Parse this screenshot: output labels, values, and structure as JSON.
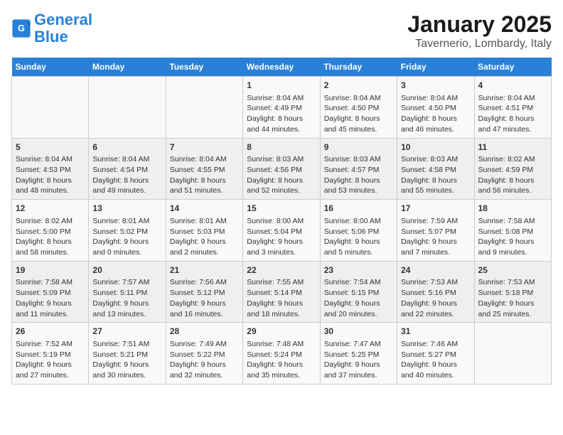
{
  "header": {
    "logo_line1": "General",
    "logo_line2": "Blue",
    "month": "January 2025",
    "location": "Tavernerio, Lombardy, Italy"
  },
  "days_of_week": [
    "Sunday",
    "Monday",
    "Tuesday",
    "Wednesday",
    "Thursday",
    "Friday",
    "Saturday"
  ],
  "weeks": [
    [
      {
        "day": "",
        "data": ""
      },
      {
        "day": "",
        "data": ""
      },
      {
        "day": "",
        "data": ""
      },
      {
        "day": "1",
        "data": "Sunrise: 8:04 AM\nSunset: 4:49 PM\nDaylight: 8 hours and 44 minutes."
      },
      {
        "day": "2",
        "data": "Sunrise: 8:04 AM\nSunset: 4:50 PM\nDaylight: 8 hours and 45 minutes."
      },
      {
        "day": "3",
        "data": "Sunrise: 8:04 AM\nSunset: 4:50 PM\nDaylight: 8 hours and 46 minutes."
      },
      {
        "day": "4",
        "data": "Sunrise: 8:04 AM\nSunset: 4:51 PM\nDaylight: 8 hours and 47 minutes."
      }
    ],
    [
      {
        "day": "5",
        "data": "Sunrise: 8:04 AM\nSunset: 4:53 PM\nDaylight: 8 hours and 48 minutes."
      },
      {
        "day": "6",
        "data": "Sunrise: 8:04 AM\nSunset: 4:54 PM\nDaylight: 8 hours and 49 minutes."
      },
      {
        "day": "7",
        "data": "Sunrise: 8:04 AM\nSunset: 4:55 PM\nDaylight: 8 hours and 51 minutes."
      },
      {
        "day": "8",
        "data": "Sunrise: 8:03 AM\nSunset: 4:56 PM\nDaylight: 8 hours and 52 minutes."
      },
      {
        "day": "9",
        "data": "Sunrise: 8:03 AM\nSunset: 4:57 PM\nDaylight: 8 hours and 53 minutes."
      },
      {
        "day": "10",
        "data": "Sunrise: 8:03 AM\nSunset: 4:58 PM\nDaylight: 8 hours and 55 minutes."
      },
      {
        "day": "11",
        "data": "Sunrise: 8:02 AM\nSunset: 4:59 PM\nDaylight: 8 hours and 56 minutes."
      }
    ],
    [
      {
        "day": "12",
        "data": "Sunrise: 8:02 AM\nSunset: 5:00 PM\nDaylight: 8 hours and 58 minutes."
      },
      {
        "day": "13",
        "data": "Sunrise: 8:01 AM\nSunset: 5:02 PM\nDaylight: 9 hours and 0 minutes."
      },
      {
        "day": "14",
        "data": "Sunrise: 8:01 AM\nSunset: 5:03 PM\nDaylight: 9 hours and 2 minutes."
      },
      {
        "day": "15",
        "data": "Sunrise: 8:00 AM\nSunset: 5:04 PM\nDaylight: 9 hours and 3 minutes."
      },
      {
        "day": "16",
        "data": "Sunrise: 8:00 AM\nSunset: 5:06 PM\nDaylight: 9 hours and 5 minutes."
      },
      {
        "day": "17",
        "data": "Sunrise: 7:59 AM\nSunset: 5:07 PM\nDaylight: 9 hours and 7 minutes."
      },
      {
        "day": "18",
        "data": "Sunrise: 7:58 AM\nSunset: 5:08 PM\nDaylight: 9 hours and 9 minutes."
      }
    ],
    [
      {
        "day": "19",
        "data": "Sunrise: 7:58 AM\nSunset: 5:09 PM\nDaylight: 9 hours and 11 minutes."
      },
      {
        "day": "20",
        "data": "Sunrise: 7:57 AM\nSunset: 5:11 PM\nDaylight: 9 hours and 13 minutes."
      },
      {
        "day": "21",
        "data": "Sunrise: 7:56 AM\nSunset: 5:12 PM\nDaylight: 9 hours and 16 minutes."
      },
      {
        "day": "22",
        "data": "Sunrise: 7:55 AM\nSunset: 5:14 PM\nDaylight: 9 hours and 18 minutes."
      },
      {
        "day": "23",
        "data": "Sunrise: 7:54 AM\nSunset: 5:15 PM\nDaylight: 9 hours and 20 minutes."
      },
      {
        "day": "24",
        "data": "Sunrise: 7:53 AM\nSunset: 5:16 PM\nDaylight: 9 hours and 22 minutes."
      },
      {
        "day": "25",
        "data": "Sunrise: 7:53 AM\nSunset: 5:18 PM\nDaylight: 9 hours and 25 minutes."
      }
    ],
    [
      {
        "day": "26",
        "data": "Sunrise: 7:52 AM\nSunset: 5:19 PM\nDaylight: 9 hours and 27 minutes."
      },
      {
        "day": "27",
        "data": "Sunrise: 7:51 AM\nSunset: 5:21 PM\nDaylight: 9 hours and 30 minutes."
      },
      {
        "day": "28",
        "data": "Sunrise: 7:49 AM\nSunset: 5:22 PM\nDaylight: 9 hours and 32 minutes."
      },
      {
        "day": "29",
        "data": "Sunrise: 7:48 AM\nSunset: 5:24 PM\nDaylight: 9 hours and 35 minutes."
      },
      {
        "day": "30",
        "data": "Sunrise: 7:47 AM\nSunset: 5:25 PM\nDaylight: 9 hours and 37 minutes."
      },
      {
        "day": "31",
        "data": "Sunrise: 7:46 AM\nSunset: 5:27 PM\nDaylight: 9 hours and 40 minutes."
      },
      {
        "day": "",
        "data": ""
      }
    ]
  ]
}
